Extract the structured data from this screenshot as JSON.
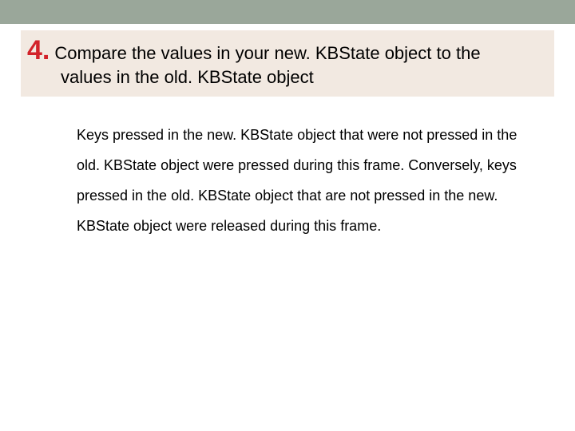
{
  "topBar": {},
  "heading": {
    "number": "4.",
    "line1": "Compare the values in your new. KBState object to the",
    "line2": "values in the old. KBState object"
  },
  "body": {
    "text": "Keys pressed in the new. KBState object that were not pressed in the old. KBState object were pressed during this frame. Conversely, keys pressed in the old. KBState object that are not pressed in the new. KBState object were released during this frame."
  }
}
